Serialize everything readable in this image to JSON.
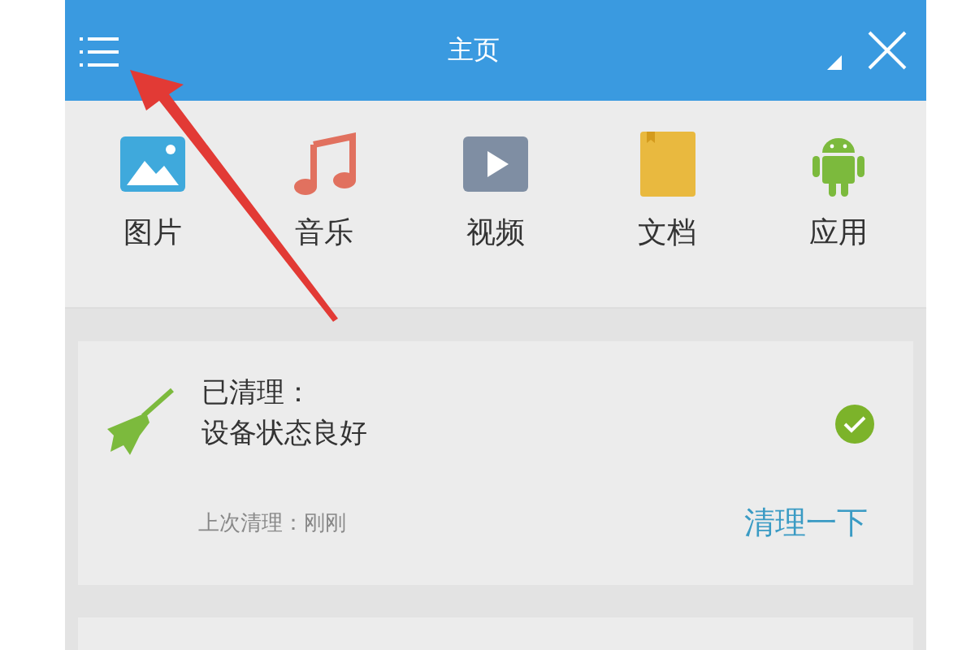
{
  "header": {
    "title": "主页"
  },
  "categories": [
    {
      "kind": "image",
      "label": "图片"
    },
    {
      "kind": "music",
      "label": "音乐"
    },
    {
      "kind": "video",
      "label": "视频"
    },
    {
      "kind": "document",
      "label": "文档"
    },
    {
      "kind": "app",
      "label": "应用"
    }
  ],
  "status_card": {
    "heading": "已清理：",
    "status": "设备状态良好",
    "done": true,
    "last_clean": "上次清理：刚刚",
    "action": "清理一下"
  }
}
